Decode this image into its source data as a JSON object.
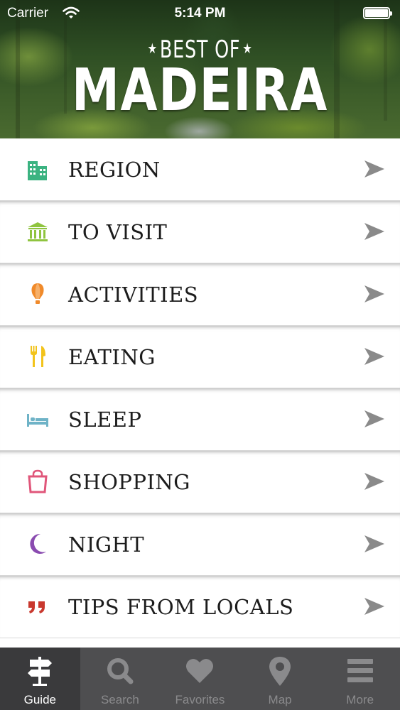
{
  "status_bar": {
    "carrier": "Carrier",
    "time": "5:14 PM"
  },
  "header": {
    "logo_top": "BEST OF",
    "logo_main": "MADEIRA"
  },
  "menu": {
    "items": [
      {
        "label": "REGION",
        "icon": "buildings-icon",
        "color": "#3bb381"
      },
      {
        "label": "TO VISIT",
        "icon": "museum-icon",
        "color": "#8fc43f"
      },
      {
        "label": "ACTIVITIES",
        "icon": "hot-air-balloon-icon",
        "color": "#f08a2a"
      },
      {
        "label": "EATING",
        "icon": "fork-knife-icon",
        "color": "#f2c31b"
      },
      {
        "label": "SLEEP",
        "icon": "bed-icon",
        "color": "#6fb3c7"
      },
      {
        "label": "SHOPPING",
        "icon": "shopping-bag-icon",
        "color": "#e0567a"
      },
      {
        "label": "NIGHT",
        "icon": "moon-icon",
        "color": "#8a4bb0"
      },
      {
        "label": "TIPS FROM LOCALS",
        "icon": "quote-icon",
        "color": "#c9382e"
      }
    ],
    "chevron_color": "#8a8a8a"
  },
  "tab_bar": {
    "tabs": [
      {
        "label": "Guide",
        "icon": "signpost-icon",
        "active": true
      },
      {
        "label": "Search",
        "icon": "search-icon",
        "active": false
      },
      {
        "label": "Favorites",
        "icon": "heart-icon",
        "active": false
      },
      {
        "label": "Map",
        "icon": "map-pin-icon",
        "active": false
      },
      {
        "label": "More",
        "icon": "menu-lines-icon",
        "active": false
      }
    ],
    "active_color": "#ffffff",
    "inactive_color": "#8a8a8c"
  }
}
